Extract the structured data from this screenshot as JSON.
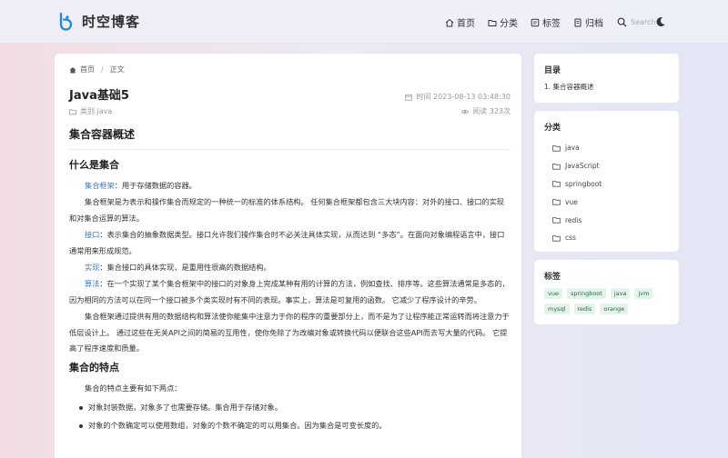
{
  "header": {
    "site_name": "时空博客",
    "nav": [
      {
        "label": "首页",
        "icon": "home-icon"
      },
      {
        "label": "分类",
        "icon": "folder-icon"
      },
      {
        "label": "标签",
        "icon": "tag-icon"
      },
      {
        "label": "归档",
        "icon": "archive-icon"
      }
    ],
    "search_placeholder": "Search",
    "accent_color": "#1e8ad6"
  },
  "breadcrumb": {
    "home": "首页",
    "separator": "/",
    "current": "正文"
  },
  "article": {
    "title": "Java基础5",
    "time": "时间 2023-08-13 03:48:30",
    "category": "类别 java",
    "views": "阅读 323次",
    "h1": "集合容器概述",
    "section1_title": "什么是集合",
    "p1_term": "集合框架",
    "p1_text": "：用于存储数据的容器。",
    "p2_text": "集合框架是为表示和操作集合而规定的一种统一的标准的体系结构。 任何集合框架都包含三大块内容：对外的接口、接口的实现和对集合运算的算法。",
    "p3_term": "接口",
    "p3_text": "：表示集合的抽象数据类型。接口允许我们操作集合时不必关注具体实现，从而达到 “多态”。在面向对象编程语言中，接口通常用来形成规范。",
    "p4_term": "实现",
    "p4_text": "：集合接口的具体实现，是重用性很高的数据结构。",
    "p5_term": "算法",
    "p5_text": "：在一个实现了某个集合框架中的接口的对象身上完成某种有用的计算的方法，例如查找、排序等。这些算法通常是多态的，因为相同的方法可以在同一个接口被多个类实现时有不同的表现。事实上，算法是可复用的函数。 它减少了程序设计的辛劳。",
    "p6_text": "集合框架通过提供有用的数据结构和算法使你能集中注意力于你的程序的重要部分上，而不是为了让程序能正常运转而将注意力于低层设计上。 通过这些在无关API之间的简易的互用性，使你免除了为改编对象或转换代码以便联合这些API而去写大量的代码。 它提高了程序速度和质量。",
    "section2_title": "集合的特点",
    "p7_text": "集合的特点主要有如下两点：",
    "bullets": [
      "对象封装数据，对象多了也需要存储。集合用于存储对象。",
      "对象的个数确定可以使用数组，对象的个数不确定的可以用集合。因为集合是可变长度的。"
    ]
  },
  "sidebar": {
    "toc_title": "目录",
    "toc_items": [
      "1. 集合容器概述"
    ],
    "categories_title": "分类",
    "categories": [
      "java",
      "JavaScript",
      "springboot",
      "vue",
      "redis",
      "css"
    ],
    "tags_title": "标签",
    "tags": [
      "vue",
      "springboot",
      "java",
      "jvm",
      "mysql",
      "redis",
      "orange"
    ]
  }
}
